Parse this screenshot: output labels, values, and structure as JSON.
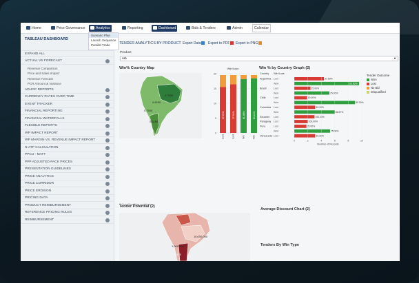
{
  "nav": {
    "items": [
      {
        "label": "Home",
        "active": false
      },
      {
        "label": "Price Governance",
        "active": false
      },
      {
        "label": "Analytics",
        "active": true
      },
      {
        "label": "Reporting",
        "active": false
      },
      {
        "label": "Dashboard",
        "active": true
      },
      {
        "label": "Bids & Tenders",
        "active": false
      },
      {
        "label": "Admin",
        "active": false
      },
      {
        "label": "Calendar",
        "active": false
      }
    ],
    "dropdown": [
      "Scenario Plan",
      "Launch Sequence",
      "Parallel Trade"
    ]
  },
  "sidebar": {
    "title": "TABLEAU DASHBOARD",
    "expand_all": "EXPAND ALL",
    "sections": [
      "ACTUAL VS FORECAST",
      "ADHOC REPORTS",
      "CURRENCY RATES OVER TIME",
      "EVENT TRACKER",
      "FINANCIAL REPORTING",
      "FINANCIAL WATERFALLS",
      "FLEXIBLE REPORTS",
      "IRP IMPACT REPORT",
      "IRP MARGIN VS. REVENUE IMPACT REPORT",
      "N-ATP CALCULATION",
      "PPCU - MATT",
      "PPP ADJUSTED PACK PRICES",
      "PRESENTATION GUIDELINES",
      "PRICE ANALYTICS",
      "PRICE CORRIDOR",
      "PRICE EROSION",
      "PRICING DATA",
      "PRODUCT REIMBURSEMENT",
      "REFERENCE PRICING RULES",
      "REIMBURSEMENT"
    ],
    "subitems": [
      "Revenue Comparison",
      "Price and Sales Impact",
      "Revenue Forecast",
      "PCR Amount & Variance"
    ]
  },
  "main": {
    "section_title": "TENDER ANALYTICS BY PRODUCT",
    "export_data": "Export Data",
    "export_pdf": "Export to PDF",
    "export_png": "Export to PNG",
    "product_label": "Product",
    "product_value": "cab",
    "map_title": "Win% Country Map",
    "map_labels": [
      "0.7600",
      "0.8250",
      "0.7500",
      "0.6250"
    ],
    "map_credit": "© OpenStreetMap contributors",
    "tender_potential_title": "Tender Potential  (2)",
    "tp_labels": [
      "10,000,000",
      "1,000,000",
      "1,600"
    ],
    "avg_discount_title": "Average Discount Chart (2)",
    "tenders_by_win_title": "Tenders By Win Type",
    "winloss_title": "Win % by Country Graph (2)"
  },
  "colors": {
    "win": "#2e9e3e",
    "lost": "#d83a34",
    "no_bid": "#f29b3a",
    "disqualified": "#c9d66b"
  },
  "chart_data": [
    {
      "type": "bar",
      "title": "Win/Loss",
      "categories": [
        "Lost",
        "Lost",
        "Win",
        "Win"
      ],
      "series": [
        {
          "name": "Win",
          "values": [
            0,
            0,
            82,
            85
          ]
        },
        {
          "name": "Lost",
          "values": [
            38,
            42,
            0,
            0
          ]
        },
        {
          "name": "No Bid",
          "values": [
            10,
            8,
            6,
            5
          ]
        }
      ],
      "data_labels": [
        "37.50%",
        "37.50%",
        "81.48%",
        "80.11%"
      ],
      "ylim": [
        0,
        20
      ],
      "yticks": [
        "0",
        "5",
        "10",
        "15",
        "20"
      ]
    },
    {
      "type": "bar",
      "columns": [
        "Country",
        "Win/Loss"
      ],
      "categories": [
        {
          "country": "Argentina",
          "outcome": "Lost",
          "value": 4.4,
          "label": "37.50%"
        },
        {
          "country": "",
          "outcome": "Won",
          "value": 9.6,
          "label": "62.50%"
        },
        {
          "country": "Brazil",
          "outcome": "Lost",
          "value": 2.4,
          "label": "25.00%"
        },
        {
          "country": "",
          "outcome": "Won",
          "value": 5.2,
          "label": "75.00%"
        },
        {
          "country": "Chile",
          "outcome": "Lost",
          "value": 1.9,
          "label": "20.00%"
        },
        {
          "country": "",
          "outcome": "Won",
          "value": 9.0,
          "label": "80.00%"
        },
        {
          "country": "Colombia",
          "outcome": "Lost",
          "value": 3.1,
          "label": "33.33%"
        },
        {
          "country": "",
          "outcome": "Won",
          "value": 6.0,
          "label": "66.67%"
        },
        {
          "country": "Ecuador",
          "outcome": "Lost",
          "value": 3.0,
          "label": "100.00%"
        },
        {
          "country": "Paraguay",
          "outcome": "Lost",
          "value": 2.0,
          "label": "100.00%"
        },
        {
          "country": "Peru",
          "outcome": "Lost",
          "value": 1.8,
          "label": "25.00%"
        },
        {
          "country": "",
          "outcome": "Won",
          "value": 5.3,
          "label": "75.00%"
        },
        {
          "country": "Venezuela",
          "outcome": "Lost",
          "value": 3.1,
          "label": "33.33%"
        }
      ],
      "xlabel": "Number of Records",
      "xticks": [
        "0",
        "2",
        "4",
        "6",
        "8",
        "10"
      ],
      "xlim": [
        0,
        10
      ],
      "legend": {
        "title": "Tender Outcome",
        "entries": [
          "Won",
          "Lost",
          "No Bid",
          "Disqualified"
        ],
        "position": "right"
      }
    }
  ]
}
